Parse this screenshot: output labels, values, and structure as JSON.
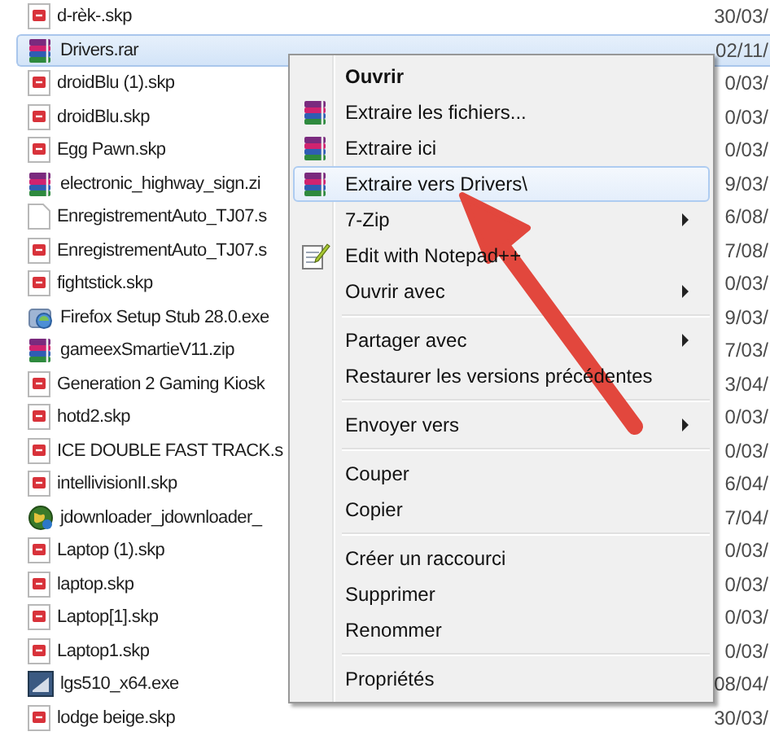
{
  "files": [
    {
      "name": "d-rèk-.skp",
      "kind": "document",
      "date": "30/03/",
      "selected": false
    },
    {
      "name": "Drivers.rar",
      "kind": "archive",
      "date": "02/11/",
      "selected": true
    },
    {
      "name": "droidBlu (1).skp",
      "kind": "document",
      "date": "0/03/",
      "selected": false
    },
    {
      "name": "droidBlu.skp",
      "kind": "document",
      "date": "0/03/",
      "selected": false
    },
    {
      "name": "Egg Pawn.skp",
      "kind": "document",
      "date": "0/03/",
      "selected": false
    },
    {
      "name": "electronic_highway_sign.zi",
      "kind": "archive",
      "date": "9/03/",
      "selected": false
    },
    {
      "name": "EnregistrementAuto_TJ07.s",
      "kind": "blank",
      "date": "6/08/",
      "selected": false
    },
    {
      "name": "EnregistrementAuto_TJ07.s",
      "kind": "document",
      "date": "7/08/",
      "selected": false
    },
    {
      "name": "fightstick.skp",
      "kind": "document",
      "date": "0/03/",
      "selected": false
    },
    {
      "name": "Firefox Setup Stub 28.0.exe",
      "kind": "installer",
      "date": "9/03/",
      "selected": false
    },
    {
      "name": "gameexSmartieV11.zip",
      "kind": "archive",
      "date": "7/03/",
      "selected": false
    },
    {
      "name": "Generation 2 Gaming Kiosk",
      "kind": "document",
      "date": "3/04/",
      "selected": false
    },
    {
      "name": "hotd2.skp",
      "kind": "document",
      "date": "0/03/",
      "selected": false
    },
    {
      "name": "ICE DOUBLE FAST TRACK.s",
      "kind": "document",
      "date": "0/03/",
      "selected": false
    },
    {
      "name": "intellivisionII.skp",
      "kind": "document",
      "date": "6/04/",
      "selected": false
    },
    {
      "name": "jdownloader_jdownloader_",
      "kind": "globe",
      "date": "7/04/",
      "selected": false
    },
    {
      "name": "Laptop (1).skp",
      "kind": "document",
      "date": "0/03/",
      "selected": false
    },
    {
      "name": "laptop.skp",
      "kind": "document",
      "date": "0/03/",
      "selected": false
    },
    {
      "name": "Laptop[1].skp",
      "kind": "document",
      "date": "0/03/",
      "selected": false
    },
    {
      "name": "Laptop1.skp",
      "kind": "document",
      "date": "0/03/",
      "selected": false
    },
    {
      "name": "lgs510_x64.exe",
      "kind": "app",
      "date": "08/04/",
      "selected": false
    },
    {
      "name": "lodge beige.skp",
      "kind": "document",
      "date": "30/03/",
      "selected": false
    }
  ],
  "context_menu": [
    {
      "kind": "plain",
      "label": "Ouvrir",
      "bold": true,
      "submenu": false,
      "selected": false
    },
    {
      "kind": "archive",
      "label": "Extraire les fichiers...",
      "bold": false,
      "submenu": false,
      "selected": false
    },
    {
      "kind": "archive",
      "label": "Extraire ici",
      "bold": false,
      "submenu": false,
      "selected": false
    },
    {
      "kind": "archive",
      "label": "Extraire vers Drivers\\",
      "bold": false,
      "submenu": false,
      "selected": true
    },
    {
      "kind": "plain",
      "label": "7-Zip",
      "bold": false,
      "submenu": true,
      "selected": false
    },
    {
      "kind": "notepad",
      "label": "Edit with Notepad++",
      "bold": false,
      "submenu": false,
      "selected": false
    },
    {
      "kind": "plain",
      "label": "Ouvrir avec",
      "bold": false,
      "submenu": true,
      "selected": false
    },
    {
      "kind": "separator"
    },
    {
      "kind": "plain",
      "label": "Partager avec",
      "bold": false,
      "submenu": true,
      "selected": false
    },
    {
      "kind": "plain",
      "label": "Restaurer les versions précédentes",
      "bold": false,
      "submenu": false,
      "selected": false
    },
    {
      "kind": "separator"
    },
    {
      "kind": "plain",
      "label": "Envoyer vers",
      "bold": false,
      "submenu": true,
      "selected": false
    },
    {
      "kind": "separator"
    },
    {
      "kind": "plain",
      "label": "Couper",
      "bold": false,
      "submenu": false,
      "selected": false
    },
    {
      "kind": "plain",
      "label": "Copier",
      "bold": false,
      "submenu": false,
      "selected": false
    },
    {
      "kind": "separator"
    },
    {
      "kind": "plain",
      "label": "Créer un raccourci",
      "bold": false,
      "submenu": false,
      "selected": false
    },
    {
      "kind": "plain",
      "label": "Supprimer",
      "bold": false,
      "submenu": false,
      "selected": false
    },
    {
      "kind": "plain",
      "label": "Renommer",
      "bold": false,
      "submenu": false,
      "selected": false
    },
    {
      "kind": "separator"
    },
    {
      "kind": "plain",
      "label": "Propriétés",
      "bold": false,
      "submenu": false,
      "selected": false
    }
  ]
}
